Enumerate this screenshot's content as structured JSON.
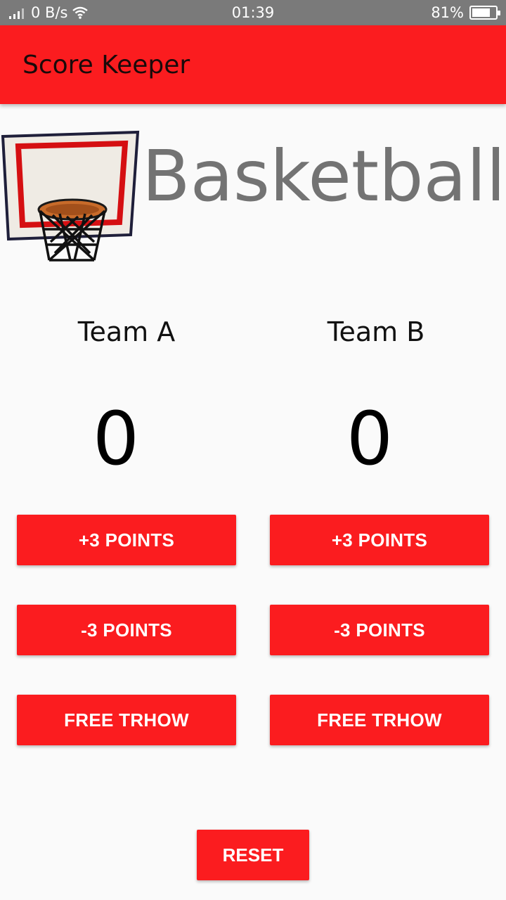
{
  "status_bar": {
    "network_speed": "0 B/s",
    "time": "01:39",
    "battery_percent": "81%",
    "battery_level": 0.81
  },
  "app_bar": {
    "title": "Score Keeper"
  },
  "header": {
    "sport_title": "Basketball",
    "icon": "basketball-hoop-icon"
  },
  "team_a": {
    "name": "Team A",
    "score": "0",
    "buttons": {
      "plus3": "+3 POINTS",
      "minus3": "-3 POINTS",
      "free_throw": "FREE TRHOW"
    }
  },
  "team_b": {
    "name": "Team B",
    "score": "0",
    "buttons": {
      "plus3": "+3 POINTS",
      "minus3": "-3 POINTS",
      "free_throw": "FREE TRHOW"
    }
  },
  "reset_label": "RESET",
  "colors": {
    "accent": "#fb1c1f",
    "status_bar": "#7a7a7a",
    "background": "#fafafa",
    "title_gray": "#737373"
  }
}
